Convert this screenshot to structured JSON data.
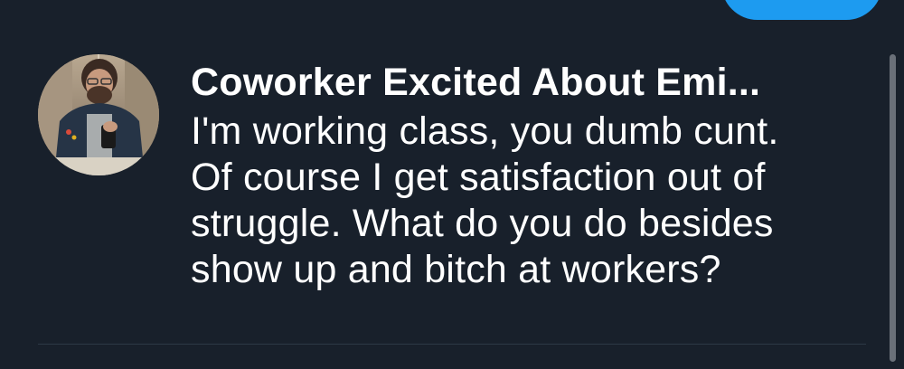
{
  "conversation": {
    "sender_name": "Coworker Excited About Emi...",
    "message_lines": [
      "I'm working class, you dumb cunt.",
      "Of course I get satisfaction out of",
      "struggle. What do you do besides",
      "show up and bitch at workers?"
    ]
  },
  "colors": {
    "background": "#18202b",
    "text": "#ffffff",
    "accent": "#1d9bf0",
    "divider": "#2c3946",
    "scrollbar": "#6a7079"
  }
}
